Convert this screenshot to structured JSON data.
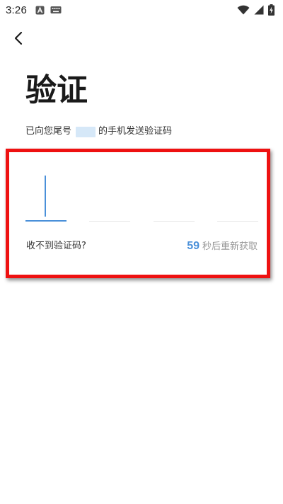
{
  "status_bar": {
    "time": "3:26",
    "left_icons": [
      "notification-a-icon",
      "keyboard-icon"
    ],
    "right_icons": [
      "wifi-icon",
      "cellular-signal-icon",
      "battery-charging-icon"
    ]
  },
  "header": {
    "back_icon": "chevron-left-icon"
  },
  "page": {
    "title": "验证",
    "subtitle_prefix": "已向您尾号",
    "subtitle_suffix": "的手机发送验证码"
  },
  "code_input": {
    "slot_count": 4,
    "active_slot": 0
  },
  "footer_row": {
    "no_code_label": "收不到验证码?",
    "countdown_seconds": "59",
    "resend_label": "秒后重新获取"
  },
  "colors": {
    "accent": "#4a90d9",
    "highlight_border": "#ee1111",
    "text_primary": "#1a1a1a",
    "text_secondary": "#333333",
    "text_muted": "#999999"
  }
}
